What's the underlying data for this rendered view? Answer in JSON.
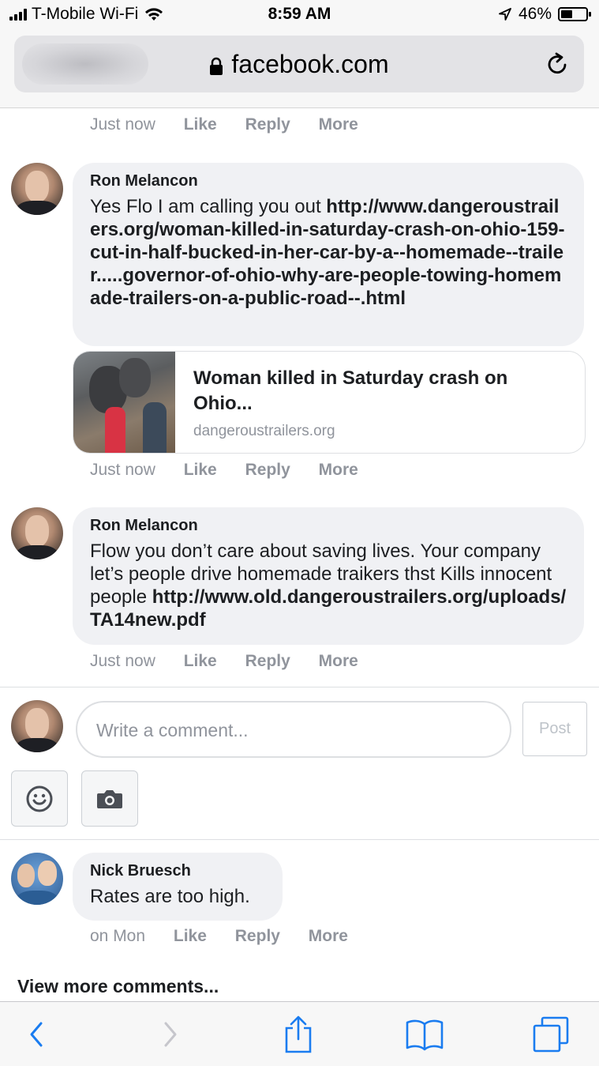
{
  "status_bar": {
    "carrier": "T-Mobile Wi-Fi",
    "time": "8:59 AM",
    "battery": "46%",
    "battery_level": 0.46
  },
  "browser": {
    "domain": "facebook.com"
  },
  "comments": [
    {
      "meta": {
        "time": "Just now",
        "like": "Like",
        "reply": "Reply",
        "more": "More"
      }
    },
    {
      "author": "Ron Melancon",
      "text_plain": "Yes Flo I am calling you out ",
      "text_link": "http://www.dangeroustrailers.org/woman-killed-in-saturday-crash-on-ohio-159-cut-in-half-bucked-in-her-car-by-a--homemade--trailer.....governor-of-ohio-why-are-people-towing-homemade-trailers-on-a-public-road--.html",
      "link_card": {
        "title": "Woman killed in Saturday crash on Ohio...",
        "domain": "dangeroustrailers.org"
      },
      "meta": {
        "time": "Just now",
        "like": "Like",
        "reply": "Reply",
        "more": "More"
      }
    },
    {
      "author": "Ron Melancon",
      "text_plain": "Flow you don’t care about saving lives. Your company let’s people drive homemade traikers thst Kills innocent people ",
      "text_link": "http://www.old.dangeroustrailers.org/uploads/TA14new.pdf",
      "meta": {
        "time": "Just now",
        "like": "Like",
        "reply": "Reply",
        "more": "More"
      }
    }
  ],
  "composer": {
    "placeholder": "Write a comment...",
    "post_label": "Post"
  },
  "other_comment": {
    "author": "Nick Bruesch",
    "text": "Rates are too high.",
    "meta": {
      "time": "on Mon",
      "like": "Like",
      "reply": "Reply",
      "more": "More"
    }
  },
  "view_more": "View more comments...",
  "colors": {
    "bubble": "#f0f1f4",
    "meta_text": "#90949c",
    "ios_blue": "#1a7cf0"
  }
}
